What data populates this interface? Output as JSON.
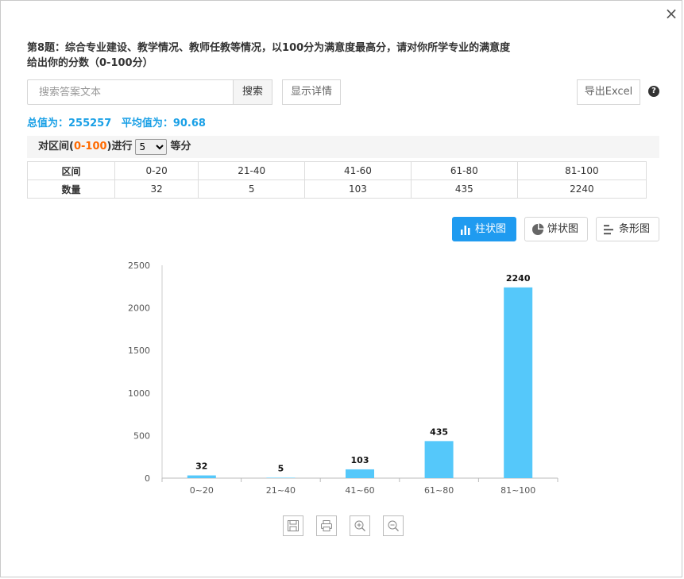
{
  "dialog": {
    "close_label": "×",
    "question": "第8题：综合专业建设、教学情况、教师任教等情况，以100分为满意度最高分，请对你所学专业的满意度给出你的分数（0-100分）"
  },
  "search": {
    "placeholder": "搜索答案文本",
    "value": "",
    "button_label": "搜索",
    "detail_label": "显示详情",
    "export_label": "导出Excel",
    "help_icon": "question-circle-icon"
  },
  "summary": {
    "total": "总值为：255257",
    "average": "平均值为：90.68"
  },
  "interval": {
    "prefix": "对区间(",
    "range": "0-100",
    "middle": ")进行",
    "selected": "5",
    "suffix": "等分"
  },
  "table": {
    "row1_label": "区间",
    "row2_label": "数量",
    "ranges": [
      "0-20",
      "21-40",
      "41-60",
      "61-80",
      "81-100"
    ],
    "counts": [
      "32",
      "5",
      "103",
      "435",
      "2240"
    ]
  },
  "chart_tabs": {
    "bar_label": "柱状图",
    "pie_label": "饼状图",
    "hbar_label": "条形图",
    "active": "bar"
  },
  "chart_data": {
    "type": "bar",
    "categories": [
      "0~20",
      "21~40",
      "41~60",
      "61~80",
      "81~100"
    ],
    "values": [
      32,
      5,
      103,
      435,
      2240
    ],
    "ylim": [
      0,
      2500
    ],
    "yticks": [
      0,
      500,
      1000,
      1500,
      2000,
      2500
    ],
    "bar_color": "#55c8fa",
    "data_labels": true
  },
  "toolbox": {
    "save_icon": "save-icon",
    "print_icon": "print-icon",
    "zoom_in_icon": "zoom-in-icon",
    "zoom_out_icon": "zoom-out-icon"
  }
}
